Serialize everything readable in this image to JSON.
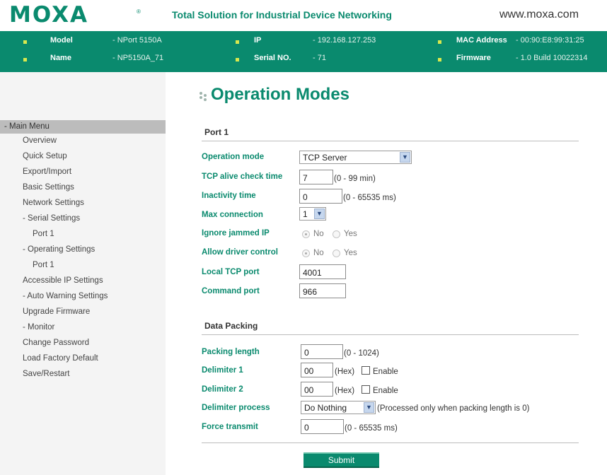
{
  "header": {
    "logo_text": "MOXA",
    "logo_mark": "®",
    "tagline": "Total Solution for Industrial Device Networking",
    "website": "www.moxa.com",
    "brand_color": "#0a8a6e"
  },
  "device_info": {
    "model_label": "Model",
    "model_value": "- NPort 5150A",
    "name_label": "Name",
    "name_value": "- NP5150A_71",
    "ip_label": "IP",
    "ip_value": "- 192.168.127.253",
    "serial_label": "Serial NO.",
    "serial_value": "- 71",
    "mac_label": "MAC Address",
    "mac_value": "- 00:90:E8:99:31:25",
    "firmware_label": "Firmware",
    "firmware_value": "- 1.0 Build 10022314"
  },
  "sidebar": {
    "head": "- Main Menu",
    "items": [
      {
        "label": "Overview"
      },
      {
        "label": "Quick Setup"
      },
      {
        "label": "Export/Import"
      },
      {
        "label": "Basic Settings"
      },
      {
        "label": "Network Settings"
      },
      {
        "label": "- Serial Settings"
      },
      {
        "label": "Port 1"
      },
      {
        "label": "- Operating Settings"
      },
      {
        "label": "Port 1"
      },
      {
        "label": "Accessible IP Settings"
      },
      {
        "label": "- Auto Warning Settings"
      },
      {
        "label": "Upgrade Firmware"
      },
      {
        "label": "- Monitor"
      },
      {
        "label": "Change Password"
      },
      {
        "label": "Load Factory Default"
      },
      {
        "label": "Save/Restart"
      }
    ]
  },
  "page": {
    "title": "Operation Modes"
  },
  "port": {
    "section": "Port 1",
    "operation_mode_label": "Operation mode",
    "operation_mode_value": "TCP Server",
    "alive_label": "TCP alive check time",
    "alive_value": "7",
    "alive_hint": "(0 - 99 min)",
    "inactivity_label": "Inactivity time",
    "inactivity_value": "0",
    "inactivity_hint": "(0 - 65535 ms)",
    "maxconn_label": "Max connection",
    "maxconn_value": "1",
    "jammed_label": "Ignore jammed IP",
    "jammed_no": "No",
    "jammed_yes": "Yes",
    "driver_label": "Allow driver control",
    "driver_no": "No",
    "driver_yes": "Yes",
    "local_port_label": "Local TCP port",
    "local_port_value": "4001",
    "command_port_label": "Command port",
    "command_port_value": "966"
  },
  "packing": {
    "section": "Data Packing",
    "length_label": "Packing length",
    "length_value": "0",
    "length_hint": "(0 - 1024)",
    "delim1_label": "Delimiter 1",
    "delim1_value": "00",
    "delim1_hex": "(Hex)",
    "delim1_enable": "Enable",
    "delim2_label": "Delimiter 2",
    "delim2_value": "00",
    "delim2_hex": "(Hex)",
    "delim2_enable": "Enable",
    "process_label": "Delimiter process",
    "process_value": "Do Nothing",
    "process_hint": "(Processed only when packing length is 0)",
    "force_label": "Force transmit",
    "force_value": "0",
    "force_hint": "(0 - 65535 ms)"
  },
  "actions": {
    "submit_label": "Submit"
  }
}
